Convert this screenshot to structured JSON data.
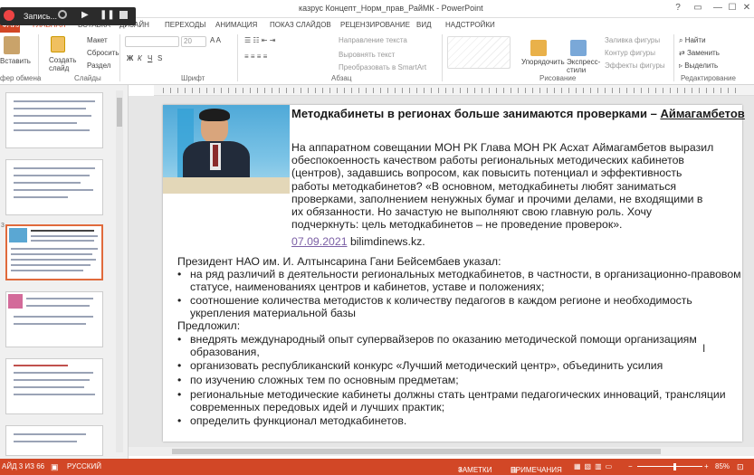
{
  "recorder": {
    "label": "Запись..."
  },
  "window": {
    "title": "казрус Концепт_Норм_прав_РайМК - PowerPoint",
    "help": "?",
    "restore": "▭",
    "minimize": "—",
    "maximize": "☐",
    "close": "✕"
  },
  "tabs": [
    {
      "label": "ФАЙЛ"
    },
    {
      "label": "ГЛАВНАЯ"
    },
    {
      "label": "ВСТАВКА"
    },
    {
      "label": "ДИЗАЙН"
    },
    {
      "label": "ПЕРЕХОДЫ"
    },
    {
      "label": "АНИМАЦИЯ"
    },
    {
      "label": "ПОКАЗ СЛАЙДОВ"
    },
    {
      "label": "РЕЦЕНЗИРОВАНИЕ"
    },
    {
      "label": "ВИД"
    },
    {
      "label": "НАДСТРОЙКИ"
    }
  ],
  "ribbon": {
    "paste": "Вставить",
    "create_slide": "Создать слайд",
    "layout": "Макет",
    "reset": "Сбросить",
    "section": "Раздел",
    "font_size": "20",
    "text_direction": "Направление текста",
    "align_text": "Выровнять текст",
    "convert_smartart": "Преобразовать в SmartArt",
    "arrange": "Упорядочить",
    "express_styles": "Экспресс-стили",
    "shape_fill": "Заливка фигуры",
    "shape_outline": "Контур фигуры",
    "shape_effects": "Эффекты фигуры",
    "find": "Найти",
    "replace": "Заменить",
    "select": "Выделить",
    "groups": {
      "clipboard": "фер обмена",
      "slides": "Слайды",
      "font": "Шрифт",
      "paragraph": "Абзац",
      "drawing": "Рисование",
      "editing": "Редактирование"
    }
  },
  "thumbnails": [
    {
      "num": ""
    },
    {
      "num": ""
    },
    {
      "num": "3"
    },
    {
      "num": ""
    },
    {
      "num": ""
    },
    {
      "num": ""
    }
  ],
  "slide": {
    "title_prefix": "Методкабинеты в регионах больше занимаются проверками – ",
    "title_name": "Аймагамбетов",
    "p1_l1": "На аппаратном совещании МОН РК Глава МОН РК Асхат Аймагамбетов выразил",
    "p1_l2": "обеспокоенность качеством работы региональных методических кабинетов",
    "p1_l3": "(центров), задавшись вопросом, как повысить потенциал и эффективность",
    "p1_l4": "работы методкабинетов? «В основном, методкабинеты любят заниматься",
    "p1_l5": "проверками, заполнением ненужных бумаг и прочими делами, не входящими в",
    "p1_l6": "их обязанности. Но зачастую не выполняют свою главную роль. Хочу",
    "p1_l7": "подчеркнуть: цель методкабинетов – не проведение проверок».",
    "date": "07.09.2021",
    "source": "bilimdinews.kz.",
    "president": "Президент НАО им. И. Алтынсарина Гани Бейсембаев указал:",
    "b1_l1": "на ряд различий в деятельности региональных методкабинетов, в частности, в организационно-правовом",
    "b1_l2": "статусе, наименованиях центров и кабинетов, уставе и положениях;",
    "b2_l1": "соотношение количества методистов к количеству педагогов в каждом регионе и необходимость",
    "b2_l2": "укрепления материальной базы",
    "proposed": "Предложил:",
    "c1_l1": "внедрять международный опыт супервайзеров по оказанию методической помощи организациям",
    "c1_l2": "образования,",
    "c2": "организовать   республиканский конкурс «Лучший методический центр», объединить усилия",
    "c3": "по изучению сложных тем по основным предметам;",
    "c4_l1": "региональные методические кабинеты должны стать центрами педагогических инноваций, трансляции",
    "c4_l2": "современных передовых идей и лучших практик;",
    "c5": "определить функционал методкабинетов.",
    "bullet": "•"
  },
  "status": {
    "slide_info": "АЙД 3 ИЗ 66",
    "language": "РУССКИЙ",
    "notes": "ЗАМЕТКИ",
    "comments": "ПРИМЕЧАНИЯ",
    "zoom": "85%"
  },
  "colors": {
    "accent": "#d24726",
    "link": "#7b5fa5"
  }
}
